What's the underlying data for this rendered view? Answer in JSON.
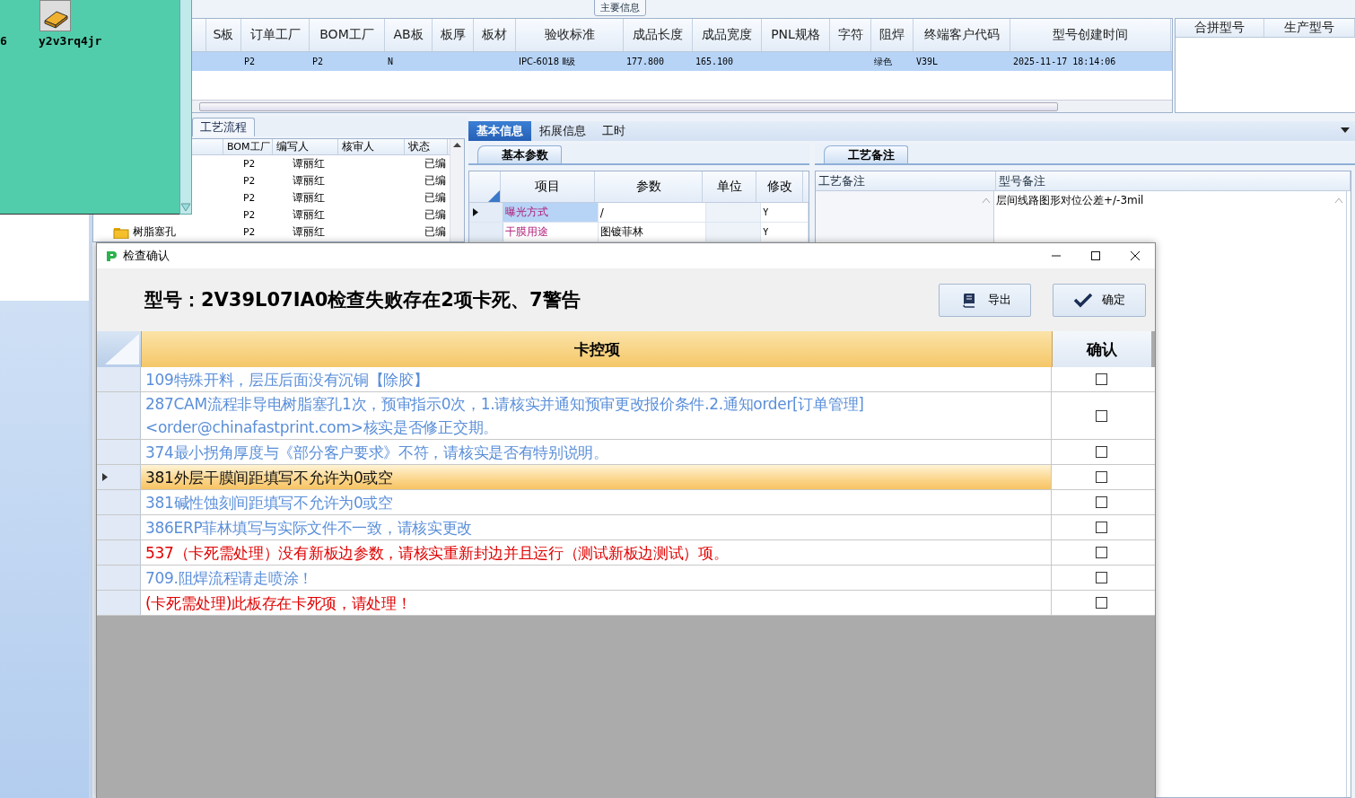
{
  "desktop_window": {
    "labels": [
      "6",
      "y2v3rq4jr"
    ]
  },
  "main_grid": {
    "group_label": "主要信息",
    "columns": [
      "S板",
      "订单工厂",
      "BOM工厂",
      "AB板",
      "板厚",
      "板材",
      "验收标准",
      "成品长度",
      "成品宽度",
      "PNL规格",
      "字符",
      "阻焊",
      "终端客户代码",
      "型号创建时间"
    ],
    "rows": [
      {
        "selected": true,
        "cells": [
          null,
          "P2",
          "P2",
          "N",
          null,
          null,
          "IPC-6018 Ⅱ级",
          "177.800",
          "165.100",
          null,
          null,
          "绿色",
          "V39L",
          "2025-11-17 18:14:06"
        ]
      }
    ]
  },
  "side_grid": {
    "columns": [
      "合拼型号",
      "生产型号"
    ]
  },
  "process_panel": {
    "tab": "工艺流程",
    "columns": [
      "BOM工厂",
      "编写人",
      "核审人",
      "状态"
    ],
    "rows": [
      {
        "bom": "P2",
        "writer": "谭丽红",
        "status": "已编"
      },
      {
        "bom": "P2",
        "writer": "谭丽红",
        "status": "已编"
      },
      {
        "bom": "P2",
        "writer": "谭丽红",
        "status": "已编"
      },
      {
        "bom": "P2",
        "writer": "谭丽红",
        "status": "已编"
      },
      {
        "name": "树脂塞孔",
        "bom": "P2",
        "writer": "谭丽红",
        "status": "已编"
      }
    ]
  },
  "info_tabs": [
    {
      "label": "基本信息",
      "selected": true
    },
    {
      "label": "拓展信息",
      "selected": false
    },
    {
      "label": "工时",
      "selected": false
    }
  ],
  "basic_params": {
    "tab": "基本参数",
    "columns": [
      "项目",
      "参数",
      "单位",
      "修改"
    ],
    "rows": [
      {
        "item": "曝光方式",
        "value": "/",
        "modified": "Y",
        "selected": true
      },
      {
        "item": "干膜用途",
        "value": "图镀菲林",
        "modified": "Y",
        "selected": false
      }
    ]
  },
  "remarks": {
    "tab": "工艺备注",
    "columns": [
      "工艺备注",
      "型号备注"
    ],
    "model_remark": "层间线路图形对位公差+/-3mil"
  },
  "dialog": {
    "title": "检查确认",
    "heading": "型号：2V39L07IA0检查失败存在2项卡死、7警告",
    "buttons": [
      {
        "kind": "export",
        "label": "导出"
      },
      {
        "kind": "confirm",
        "label": "确定"
      }
    ],
    "columns": [
      "卡控项",
      "确认"
    ],
    "rows": [
      {
        "text": "109特殊开料，层压后面没有沉铜【除胶】",
        "kind": "warning",
        "selected": false,
        "checked": false
      },
      {
        "text": "287CAM流程非导电树脂塞孔1次，预审指示0次，1.请核实并通知预审更改报价条件.2.通知order[订单管理] <order@chinafastprint.com>核实是否修正交期。",
        "kind": "warning",
        "selected": false,
        "checked": false
      },
      {
        "text": "374最小拐角厚度与《部分客户要求》不符，请核实是否有特别说明。",
        "kind": "warning",
        "selected": false,
        "checked": false
      },
      {
        "text": "381外层干膜间距填写不允许为0或空",
        "kind": "warning",
        "selected": true,
        "checked": false
      },
      {
        "text": "381碱性蚀刻间距填写不允许为0或空",
        "kind": "warning",
        "selected": false,
        "checked": false
      },
      {
        "text": "386ERP菲林填写与实际文件不一致，请核实更改",
        "kind": "warning",
        "selected": false,
        "checked": false
      },
      {
        "text": "537（卡死需处理）没有新板边参数，请核实重新封边并且运行（测试新板边测试）项。",
        "kind": "blocking",
        "selected": false,
        "checked": false
      },
      {
        "text": "709.阻焊流程请走喷涂！",
        "kind": "warning",
        "selected": false,
        "checked": false
      },
      {
        "text": "(卡死需处理)此板存在卡死项，请处理！",
        "kind": "blocking",
        "selected": false,
        "checked": false
      }
    ]
  }
}
